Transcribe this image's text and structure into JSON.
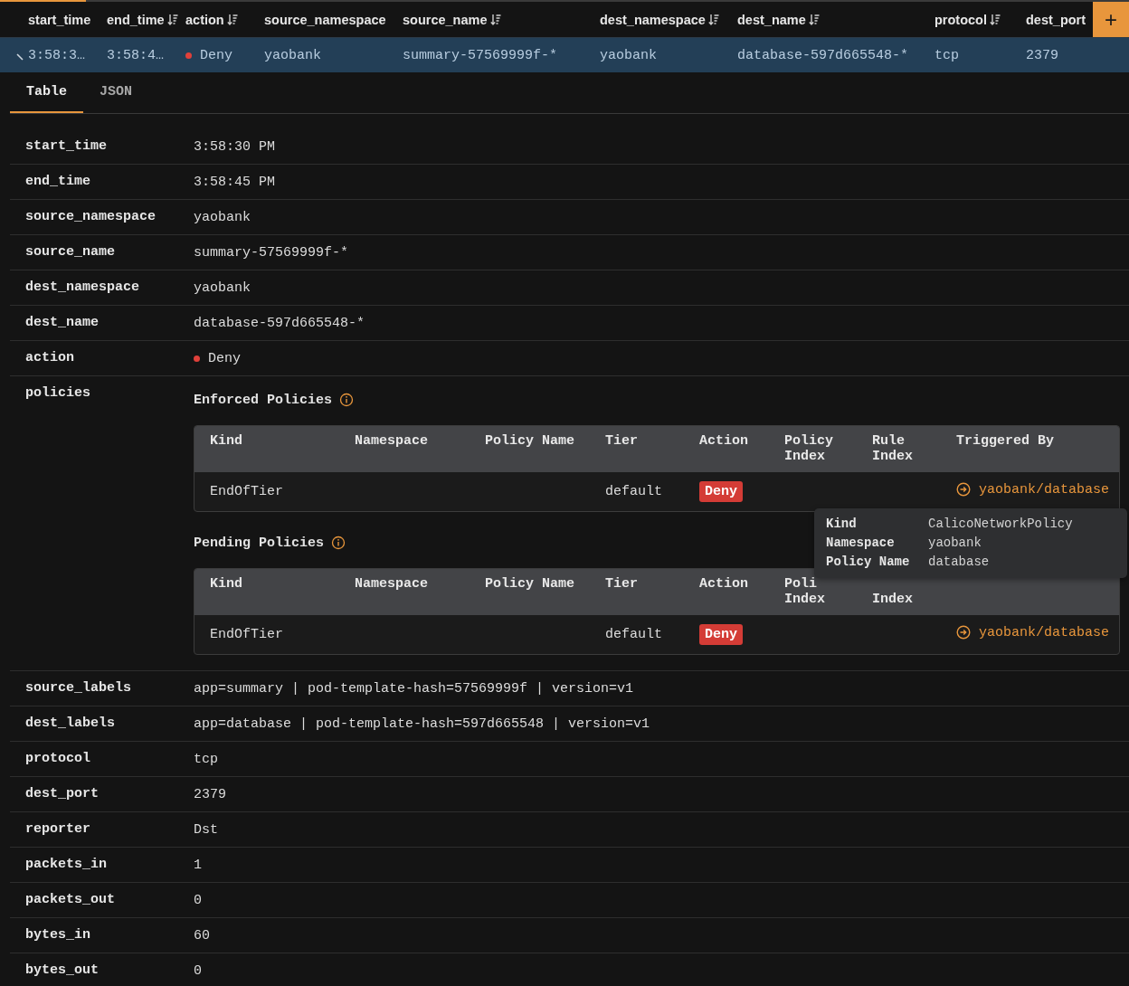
{
  "grid": {
    "columns": [
      {
        "label": "start_time",
        "sortable": false
      },
      {
        "label": "end_time",
        "sortable": true
      },
      {
        "label": "action",
        "sortable": true
      },
      {
        "label": "source_namespace",
        "sortable": false
      },
      {
        "label": "source_name",
        "sortable": true
      },
      {
        "label": "dest_namespace",
        "sortable": true
      },
      {
        "label": "dest_name",
        "sortable": true
      },
      {
        "label": "protocol",
        "sortable": true
      },
      {
        "label": "dest_port",
        "sortable": false
      }
    ],
    "add_button": "+",
    "rows": [
      {
        "expanded": true,
        "selected": true,
        "cells": [
          {
            "text": "3:58:3…"
          },
          {
            "text": "3:58:4…"
          },
          {
            "text": "Deny",
            "kind": "status",
            "color": "#e0403a"
          },
          {
            "text": "yaobank"
          },
          {
            "text": "summary-57569999f-*"
          },
          {
            "text": "yaobank"
          },
          {
            "text": "database-597d665548-*"
          },
          {
            "text": "tcp"
          },
          {
            "text": "2379"
          }
        ]
      }
    ]
  },
  "tabs": [
    {
      "label": "Table",
      "selected": true
    },
    {
      "label": "JSON",
      "selected": false
    }
  ],
  "details": [
    {
      "label": "start_time",
      "kind": "text",
      "value": "3:58:30 PM"
    },
    {
      "label": "end_time",
      "kind": "text",
      "value": "3:58:45 PM"
    },
    {
      "label": "source_namespace",
      "kind": "text",
      "value": "yaobank"
    },
    {
      "label": "source_name",
      "kind": "text",
      "value": "summary-57569999f-*"
    },
    {
      "label": "dest_namespace",
      "kind": "text",
      "value": "yaobank"
    },
    {
      "label": "dest_name",
      "kind": "text",
      "value": "database-597d665548-*"
    },
    {
      "label": "action",
      "kind": "status",
      "value": "Deny",
      "color": "#e0403a"
    },
    {
      "label": "policies",
      "kind": "policies",
      "sections": [
        {
          "title": "Enforced Policies",
          "columns": [
            {
              "line1": "Kind"
            },
            {
              "line1": "Namespace"
            },
            {
              "line1": "Policy Name"
            },
            {
              "line1": "Tier"
            },
            {
              "line1": "Action"
            },
            {
              "line1": "Policy",
              "line2": "Index"
            },
            {
              "line1": "Rule",
              "line2": "Index"
            },
            {
              "line1": "Triggered By"
            }
          ],
          "rows": [
            {
              "kind": "EndOfTier",
              "tier": "default",
              "action": "Deny",
              "triggered_by": "yaobank/database"
            }
          ],
          "tooltip": [
            {
              "key": "Kind",
              "value": "CalicoNetworkPolicy"
            },
            {
              "key": "Namespace",
              "value": "yaobank"
            },
            {
              "key": "Policy Name",
              "value": "database"
            }
          ]
        },
        {
          "title": "Pending Policies",
          "columns": [
            {
              "line1": "Kind"
            },
            {
              "line1": "Namespace"
            },
            {
              "line1": "Policy Name"
            },
            {
              "line1": "Tier"
            },
            {
              "line1": "Action"
            },
            {
              "line1": "Poli",
              "line2": "Index"
            },
            {
              "line2": "Index"
            },
            {}
          ],
          "rows": [
            {
              "kind": "EndOfTier",
              "tier": "default",
              "action": "Deny",
              "triggered_by": "yaobank/database"
            }
          ]
        }
      ]
    },
    {
      "label": "source_labels",
      "kind": "text",
      "value": "app=summary | pod-template-hash=57569999f | version=v1"
    },
    {
      "label": "dest_labels",
      "kind": "text",
      "value": "app=database | pod-template-hash=597d665548 | version=v1"
    },
    {
      "label": "protocol",
      "kind": "text",
      "value": "tcp"
    },
    {
      "label": "dest_port",
      "kind": "text",
      "value": "2379"
    },
    {
      "label": "reporter",
      "kind": "text",
      "value": "Dst"
    },
    {
      "label": "packets_in",
      "kind": "text",
      "value": "1"
    },
    {
      "label": "packets_out",
      "kind": "text",
      "value": "0"
    },
    {
      "label": "bytes_in",
      "kind": "text",
      "value": "60"
    },
    {
      "label": "bytes_out",
      "kind": "text",
      "value": "0"
    }
  ]
}
